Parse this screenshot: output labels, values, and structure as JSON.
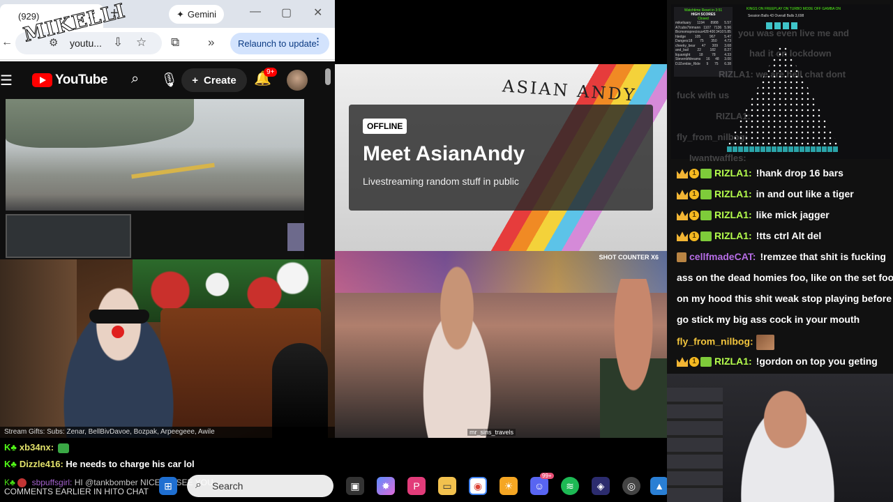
{
  "browser": {
    "tab_count": "(929)",
    "tab_title": "",
    "gemini_label": "Gemini",
    "address": "youtu...",
    "relaunch_label": "Relaunch to update",
    "sticker_text": "MIKELLI"
  },
  "youtube": {
    "logo_text": "YouTube",
    "create_label": "Create",
    "notif_badge": "9+"
  },
  "clown_stream": {
    "ticker": "Stream Gifts: Subs: Zenar, BellBivDavoe, Bozpak, Arpeegeee, Awile"
  },
  "offline_panel": {
    "art_title": "ASIAN ANDY",
    "badge": "OFFLINE",
    "name": "Meet AsianAndy",
    "description": "Livestreaming random stuff in public"
  },
  "travel_stream": {
    "shot_counter": "SHOT COUNTER  X6",
    "watermark": "mr_sins_travels"
  },
  "bottom_chat": [
    {
      "user": "xb34nx:",
      "text": ""
    },
    {
      "user": "Dizzle416:",
      "text": "He needs to charge his car lol"
    }
  ],
  "overlay_texts": {
    "line1_user": "sbpuffsgirl:",
    "line1_text": "HI @tankbomber NICE TO SEE YOU",
    "comments": "COMMENTS EARLIER IN HITO CHAT"
  },
  "taskbar": {
    "search_placeholder": "Search",
    "discord_badge": "99+"
  },
  "plinko": {
    "title": "HIGH SCORES",
    "subtitle": "Closed",
    "header": "Watchtime Reset in 3:51",
    "stats": "KINGS ON   FREEPLAY ON   TURBO MODE OFF   GAMBA ON",
    "stats2": "Session Balls 43   Overall Balls 3,698",
    "rows": [
      {
        "name": "mikeliuary",
        "a": "1194",
        "b": "8988",
        "c": "5.57"
      },
      {
        "name": "A7cubs7trimann",
        "a": "1107",
        "b": "7136",
        "c": "5.96"
      },
      {
        "name": "Bicmomsprecious428",
        "a": "400",
        "b": "3410",
        "c": "5.85"
      },
      {
        "name": "hledge",
        "a": "105",
        "b": "967",
        "c": "5.47"
      },
      {
        "name": "Dangerz18",
        "a": "75",
        "b": "350",
        "c": "4.73"
      },
      {
        "name": "cheeky_bear",
        "a": "47",
        "b": "309",
        "c": "3.68"
      },
      {
        "name": "and_bail",
        "a": "22",
        "b": "182",
        "c": "8.27"
      },
      {
        "name": "liquanight",
        "a": "18",
        "b": "78",
        "c": "4.33"
      },
      {
        "name": "Stevenbfdreams",
        "a": "16",
        "b": "48",
        "c": "3.00"
      },
      {
        "name": "DJZombie_Ride",
        "a": "9",
        "b": "75",
        "c": "6.38"
      }
    ],
    "ghost_lines": [
      "you was even live me and",
      "had it on lockdown",
      "RIZLA1: we are hell chat dont",
      "fuck with us",
      "RIZLA1:",
      "fly_from_nilbog:",
      "Iwantwaffles:"
    ]
  },
  "chat": [
    {
      "badges": "full",
      "user": "RIZLA1:",
      "color": "g",
      "text": "!hank drop 16 bars"
    },
    {
      "badges": "full",
      "user": "RIZLA1:",
      "color": "g",
      "text": "in and out like a tiger"
    },
    {
      "badges": "full",
      "user": "RIZLA1:",
      "color": "g",
      "text": "like mick jagger"
    },
    {
      "badges": "full",
      "user": "RIZLA1:",
      "color": "g",
      "text": "!tts ctrl Alt del"
    },
    {
      "badges": "box",
      "user": "cellfmadeCAT:",
      "color": "p",
      "text": "!remzee that shit is fucking"
    },
    {
      "badges": "none",
      "user": "",
      "color": "",
      "text": "ass on the dead homies foo, like on the set foo"
    },
    {
      "badges": "none",
      "user": "",
      "color": "",
      "text": "on my hood this shit weak stop playing before I"
    },
    {
      "badges": "none",
      "user": "",
      "color": "",
      "text": "go stick my big ass cock in your mouth"
    },
    {
      "badges": "none",
      "user": "fly_from_nilbog:",
      "color": "y",
      "text": ""
    },
    {
      "badges": "full",
      "user": "RIZLA1:",
      "color": "g",
      "text": "!gordon on top you geting"
    }
  ],
  "colors": {
    "kick_green": "#53fc18",
    "youtube_red": "#ff0000",
    "relaunch_bg": "#d3e3fd"
  }
}
